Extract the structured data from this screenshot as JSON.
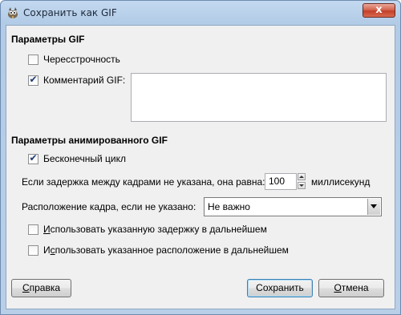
{
  "window": {
    "title": "Сохранить как GIF",
    "close_glyph": "x"
  },
  "icons": {
    "app": "gimp-icon",
    "close": "close-icon",
    "dropdown": "chevron-down-icon",
    "spin_up": "arrow-up-icon",
    "spin_down": "arrow-down-icon",
    "check": "checkmark-icon"
  },
  "gif_params": {
    "title": "Параметры GIF",
    "interlace": {
      "label": "Чересстрочность",
      "checked": false
    },
    "comment": {
      "label": "Комментарий GIF:",
      "checked": true,
      "value": ""
    }
  },
  "anim_params": {
    "title": "Параметры анимированного GIF",
    "loop": {
      "label": "Бесконечный цикл",
      "checked": true
    },
    "delay": {
      "label": "Если задержка между кадрами не указана, она равна:",
      "value": "100",
      "unit": "миллисекунд"
    },
    "disposal": {
      "label": "Расположение кадра, если не указано:",
      "selected": "Не важно"
    },
    "use_delay": {
      "label_first": "И",
      "label_rest": "спользовать указанную задержку в дальнейшем",
      "checked": false
    },
    "use_disposal": {
      "label_first": "И",
      "label_underline": "с",
      "label_rest": "пользовать указанное расположение в дальнейшем",
      "checked": false
    }
  },
  "buttons": {
    "help": {
      "first": "С",
      "rest": "правка"
    },
    "save": {
      "label": "Сохранить"
    },
    "cancel": {
      "first": "О",
      "rest": "тмена"
    }
  },
  "colors": {
    "titlebar": "#b9cfe8",
    "dialog_bg": "#f0f0f0",
    "check": "#1d3c78",
    "close_button": "#c2402a"
  }
}
